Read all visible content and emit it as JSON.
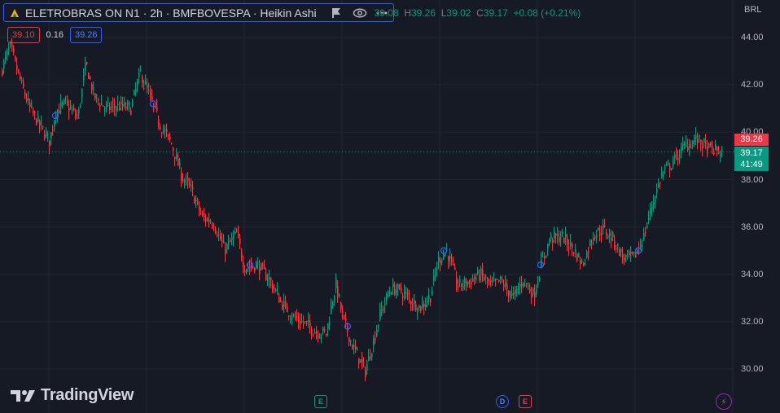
{
  "header": {
    "title": "ELETROBRAS ON N1 · 2h · BMFBOVESPA · Heikin Ashi",
    "ohlc": {
      "o_label": "O",
      "o_value": "39.08",
      "h_label": "H",
      "h_value": "39.26",
      "l_label": "L",
      "l_value": "39.02",
      "c_label": "C",
      "c_value": "39.17",
      "change": "+0.08 (+0.21%)"
    }
  },
  "quote": {
    "bid": "39.10",
    "spread": "0.16",
    "ask": "39.26"
  },
  "price_axis": {
    "currency": "BRL",
    "ticks": [
      "44.00",
      "42.00",
      "40.00",
      "38.00",
      "36.00",
      "34.00",
      "32.00",
      "30.00"
    ],
    "ask_tag": "39.26",
    "last_tag": "39.17",
    "countdown": "41:49"
  },
  "events": [
    {
      "letter": "E",
      "color": "#089981"
    },
    {
      "letter": "D",
      "color": "#2962ff"
    },
    {
      "letter": "E",
      "color": "#f23645"
    },
    {
      "letter": "⚡",
      "color": "#9c27b0"
    }
  ],
  "logo": "TradingView",
  "colors": {
    "up": "#089981",
    "down": "#f23645",
    "background": "#161a25",
    "grid": "#232632",
    "accent": "#2962ff"
  },
  "chart_data": {
    "type": "candlestick",
    "style": "Heikin Ashi",
    "interval": "2h",
    "ylim": [
      29.3,
      45.2
    ],
    "grid": true,
    "last_price": 39.17,
    "anchors": [
      [
        0,
        42.5
      ],
      [
        12,
        43.6
      ],
      [
        24,
        42.2
      ],
      [
        36,
        41.0
      ],
      [
        48,
        40.3
      ],
      [
        60,
        39.6
      ],
      [
        68,
        40.9
      ],
      [
        80,
        41.2
      ],
      [
        95,
        40.6
      ],
      [
        105,
        42.9
      ],
      [
        115,
        41.5
      ],
      [
        130,
        41.0
      ],
      [
        145,
        41.1
      ],
      [
        160,
        41.0
      ],
      [
        172,
        42.5
      ],
      [
        182,
        41.6
      ],
      [
        195,
        40.4
      ],
      [
        210,
        39.5
      ],
      [
        222,
        38.2
      ],
      [
        235,
        37.5
      ],
      [
        248,
        36.4
      ],
      [
        262,
        36.2
      ],
      [
        275,
        35.0
      ],
      [
        290,
        35.7
      ],
      [
        300,
        34.3
      ],
      [
        315,
        34.4
      ],
      [
        330,
        33.8
      ],
      [
        345,
        32.8
      ],
      [
        360,
        32.2
      ],
      [
        375,
        31.9
      ],
      [
        388,
        31.6
      ],
      [
        400,
        31.5
      ],
      [
        412,
        33.6
      ],
      [
        420,
        32.2
      ],
      [
        432,
        31.0
      ],
      [
        448,
        29.9
      ],
      [
        458,
        31.2
      ],
      [
        468,
        32.5
      ],
      [
        480,
        33.4
      ],
      [
        492,
        33.3
      ],
      [
        504,
        32.9
      ],
      [
        516,
        32.6
      ],
      [
        528,
        33.1
      ],
      [
        538,
        34.6
      ],
      [
        548,
        35.0
      ],
      [
        562,
        33.5
      ],
      [
        575,
        33.7
      ],
      [
        590,
        34.0
      ],
      [
        602,
        33.5
      ],
      [
        615,
        33.7
      ],
      [
        630,
        33.0
      ],
      [
        642,
        33.8
      ],
      [
        655,
        33.1
      ],
      [
        664,
        34.4
      ],
      [
        675,
        35.5
      ],
      [
        690,
        35.6
      ],
      [
        705,
        35.0
      ],
      [
        715,
        34.4
      ],
      [
        728,
        35.7
      ],
      [
        740,
        35.9
      ],
      [
        752,
        35.5
      ],
      [
        765,
        34.7
      ],
      [
        778,
        34.7
      ],
      [
        790,
        35.6
      ],
      [
        800,
        36.9
      ],
      [
        812,
        38.2
      ],
      [
        825,
        38.7
      ],
      [
        840,
        39.4
      ],
      [
        855,
        39.7
      ],
      [
        870,
        39.3
      ],
      [
        884,
        39.17
      ]
    ],
    "markers": [
      [
        68,
        40.7
      ],
      [
        188,
        41.2
      ],
      [
        307,
        34.4
      ],
      [
        427,
        31.8
      ],
      [
        545,
        35.0
      ],
      [
        664,
        34.4
      ],
      [
        784,
        35.0
      ]
    ]
  }
}
